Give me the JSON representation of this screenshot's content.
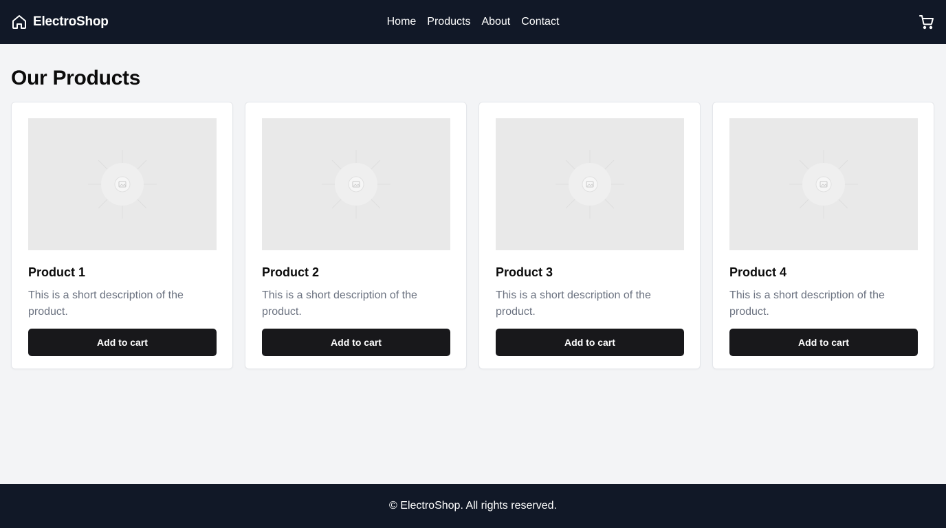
{
  "app": {
    "brand": "ElectroShop",
    "home_icon": "home-icon",
    "cart_icon": "cart-icon"
  },
  "nav": {
    "items": [
      {
        "label": "Home"
      },
      {
        "label": "Products"
      },
      {
        "label": "About"
      },
      {
        "label": "Contact"
      }
    ]
  },
  "main": {
    "title": "Our Products",
    "products": [
      {
        "title": "Product 1",
        "description": "This is a short description of the product.",
        "button": "Add to cart",
        "image_icon": "image-placeholder-icon"
      },
      {
        "title": "Product 2",
        "description": "This is a short description of the product.",
        "button": "Add to cart",
        "image_icon": "image-placeholder-icon"
      },
      {
        "title": "Product 3",
        "description": "This is a short description of the product.",
        "button": "Add to cart",
        "image_icon": "image-placeholder-icon"
      },
      {
        "title": "Product 4",
        "description": "This is a short description of the product.",
        "button": "Add to cart",
        "image_icon": "image-placeholder-icon"
      }
    ]
  },
  "footer": {
    "text": "© ElectroShop. All rights reserved."
  },
  "colors": {
    "header_bg": "#111827",
    "page_bg": "#f3f4f6",
    "button_bg": "#18181b",
    "muted_text": "#6b7280"
  }
}
